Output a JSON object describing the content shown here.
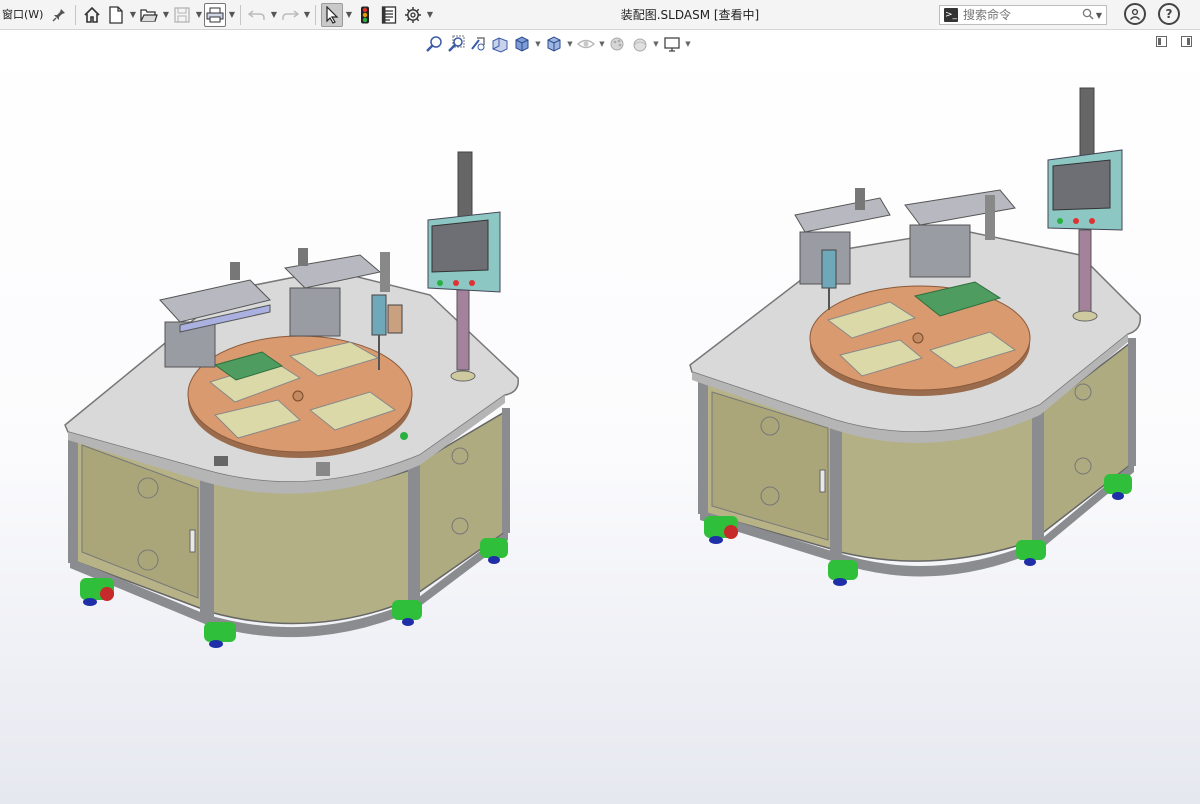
{
  "menu": {
    "window_label": "窗口(W)"
  },
  "document": {
    "title": "装配图.SLDASM [查看中]"
  },
  "search": {
    "placeholder": "搜索命令"
  },
  "toolbar": {
    "icons": [
      "pin-icon",
      "home-icon",
      "new-document-icon",
      "open-icon",
      "save-icon",
      "print-icon",
      "undo-icon",
      "redo-icon",
      "select-icon",
      "traffic-light-icon",
      "file-properties-icon",
      "options-icon"
    ]
  },
  "view_toolbar": {
    "icons": [
      "zoom-to-fit-icon",
      "zoom-to-area-icon",
      "previous-view-icon",
      "section-view-icon",
      "view-orientation-icon",
      "display-style-icon",
      "hide-show-items-icon",
      "edit-appearance-icon",
      "apply-scene-icon",
      "view-settings-icon"
    ]
  },
  "colors": {
    "cabinet_panel": "#b7b386",
    "frame_gray": "#8a8c90",
    "table_top": "#d9d9d9",
    "rotary_plate": "#d99a6f",
    "fixture_plate": "#dcd9a9",
    "pcb_green": "#4e9c60",
    "hmi_teal": "#8cc7c4",
    "caster_green": "#2fbf3a",
    "caster_blue": "#1f2fa8",
    "caster_red": "#c62a2a",
    "column_purple": "#a4829c"
  }
}
